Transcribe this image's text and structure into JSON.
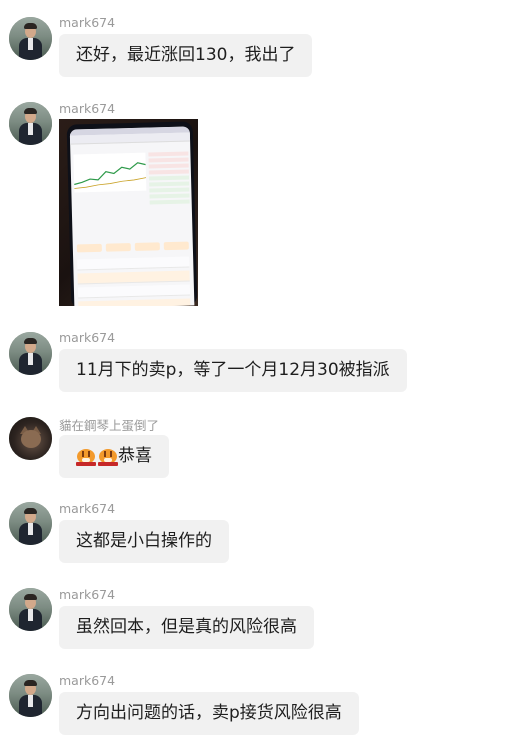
{
  "messages": [
    {
      "sender": "mark674",
      "text": "还好，最近涨回130，我出了"
    },
    {
      "sender": "mark674",
      "image": "stock-app-phone-photo"
    },
    {
      "sender": "mark674",
      "text": "11月下的卖p，等了一个月12月30被指派"
    },
    {
      "sender": "貓在鋼琴上蛋倒了",
      "emoji": [
        "tiger-sticker-icon",
        "tiger-sticker-icon"
      ],
      "text": "恭喜"
    },
    {
      "sender": "mark674",
      "text": "这都是小白操作的"
    },
    {
      "sender": "mark674",
      "text": "虽然回本，但是真的风险很高"
    },
    {
      "sender": "mark674",
      "text": "方向出问题的话，卖p接货风险很高"
    }
  ],
  "colors": {
    "bubble": "#f1f1f1",
    "sender": "#9a9a9a",
    "text": "#1e1e1e"
  }
}
